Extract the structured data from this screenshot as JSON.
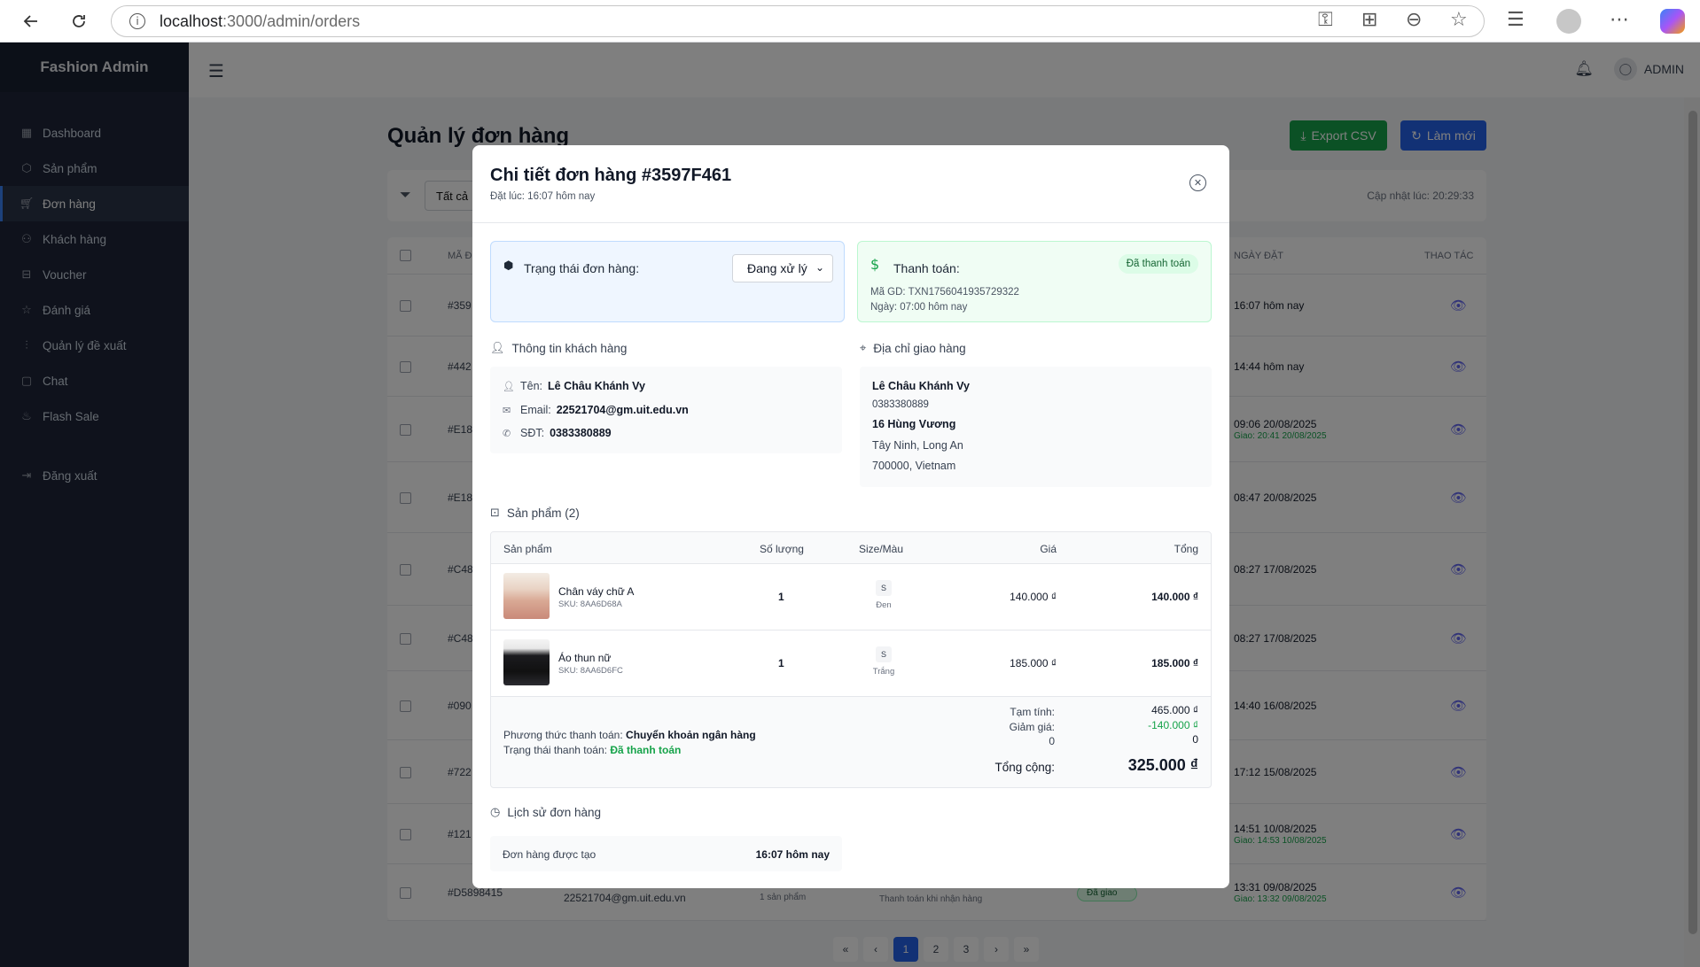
{
  "browser": {
    "url_host": "localhost",
    "url_path": ":3000/admin/orders"
  },
  "sidebar": {
    "brand": "Fashion Admin",
    "items": [
      {
        "label": "Dashboard",
        "icon": "dashboard-icon"
      },
      {
        "label": "Sản phẩm",
        "icon": "box-icon"
      },
      {
        "label": "Đơn hàng",
        "icon": "cart-icon",
        "active": true
      },
      {
        "label": "Khách hàng",
        "icon": "users-icon"
      },
      {
        "label": "Voucher",
        "icon": "gift-icon"
      },
      {
        "label": "Đánh giá",
        "icon": "star-icon"
      },
      {
        "label": "Quản lý đề xuất",
        "icon": "chart-icon"
      },
      {
        "label": "Chat",
        "icon": "chat-icon"
      },
      {
        "label": "Flash Sale",
        "icon": "flame-icon"
      }
    ],
    "logout": "Đăng xuất"
  },
  "topbar": {
    "user": "ADMIN"
  },
  "page": {
    "title": "Quản lý đơn hàng",
    "export_label": "Export CSV",
    "refresh_label": "Làm mới",
    "filter_value": "Tất cả",
    "updated_at": "Cập nhật lúc: 20:29:33",
    "col_code": "MÃ Đ",
    "col_date": "NGÀY ĐẶT",
    "col_actions": "THAO TÁC",
    "rows": [
      {
        "code": "#359",
        "date": "16:07 hôm nay",
        "deliver": ""
      },
      {
        "code": "#442",
        "date": "14:44 hôm nay",
        "deliver": ""
      },
      {
        "code": "#E18",
        "date": "09:06 20/08/2025",
        "deliver": "Giao: 20:41 20/08/2025"
      },
      {
        "code": "#E18",
        "date": "08:47 20/08/2025",
        "deliver": ""
      },
      {
        "code": "#C48",
        "date": "08:27 17/08/2025",
        "deliver": ""
      },
      {
        "code": "#C48",
        "date": "08:27 17/08/2025",
        "deliver": ""
      },
      {
        "code": "#090",
        "date": "14:40 16/08/2025",
        "deliver": ""
      },
      {
        "code": "#722",
        "date": "17:12 15/08/2025",
        "deliver": ""
      },
      {
        "code": "#121",
        "date": "14:51 10/08/2025",
        "deliver": "Giao: 14:53 10/08/2025"
      },
      {
        "code": "#D5898415",
        "date": "13:31 09/08/2025",
        "deliver": "Giao: 13:32 09/08/2025"
      }
    ],
    "last_row_email": "22521704@gm.uit.edu.vn",
    "last_row_items": "1 sản phẩm",
    "last_row_payment": "Thanh toán khi nhận hàng",
    "last_row_status": "Đã giao",
    "pages": [
      "«",
      "‹",
      "1",
      "2",
      "3",
      "›",
      "»"
    ]
  },
  "modal": {
    "title": "Chi tiết đơn hàng #3597F461",
    "placed_at": "Đặt lúc: 16:07 hôm nay",
    "status_label": "Trạng thái đơn hàng:",
    "status_value": "Đang xử lý",
    "payment_label": "Thanh toán:",
    "payment_badge": "Đã thanh toán",
    "transaction": "Mã GD: TXN1756041935729322",
    "payment_date": "Ngày: 07:00 hôm nay",
    "customer_heading": "Thông tin khách hàng",
    "name_label": "Tên:",
    "name": "Lê Châu Khánh Vy",
    "email_label": "Email:",
    "email": "22521704@gm.uit.edu.vn",
    "phone_label": "SĐT:",
    "phone": "0383380889",
    "address_heading": "Địa chỉ giao hàng",
    "addr_name": "Lê Châu Khánh Vy",
    "addr_phone": "0383380889",
    "addr_street": "16 Hùng Vương",
    "addr_city": "Tây Ninh, Long An",
    "addr_zip": "700000, Vietnam",
    "products_heading": "Sản phẩm (2)",
    "columns": {
      "product": "Sản phẩm",
      "qty": "Số lượng",
      "size": "Size/Màu",
      "price": "Giá",
      "total": "Tổng"
    },
    "products": [
      {
        "name": "Chân váy chữ A",
        "sku": "SKU: 8AA6D68A",
        "qty": "1",
        "size": "S",
        "color": "Đen",
        "price": "140.000 ₫",
        "total": "140.000 ₫"
      },
      {
        "name": "Áo thun nữ",
        "sku": "SKU: 8AA6D6FC",
        "qty": "1",
        "size": "S",
        "color": "Trắng",
        "price": "185.000 ₫",
        "total": "185.000 ₫"
      }
    ],
    "payment_method_label": "Phương thức thanh toán:",
    "payment_method": "Chuyển khoản ngân hàng",
    "payment_status_label": "Trạng thái thanh toán:",
    "payment_status": "Đã thanh toán",
    "subtotal_label": "Tạm tính:",
    "subtotal": "465.000 ₫",
    "discount_label": "Giảm giá:",
    "discount": "-140.000 ₫",
    "extra_label": "0",
    "extra_value": "0",
    "grand_total_label": "Tổng cộng:",
    "grand_total": "325.000 ₫",
    "history_heading": "Lịch sử đơn hàng",
    "history_event": "Đơn hàng được tạo",
    "history_time": "16:07 hôm nay"
  }
}
